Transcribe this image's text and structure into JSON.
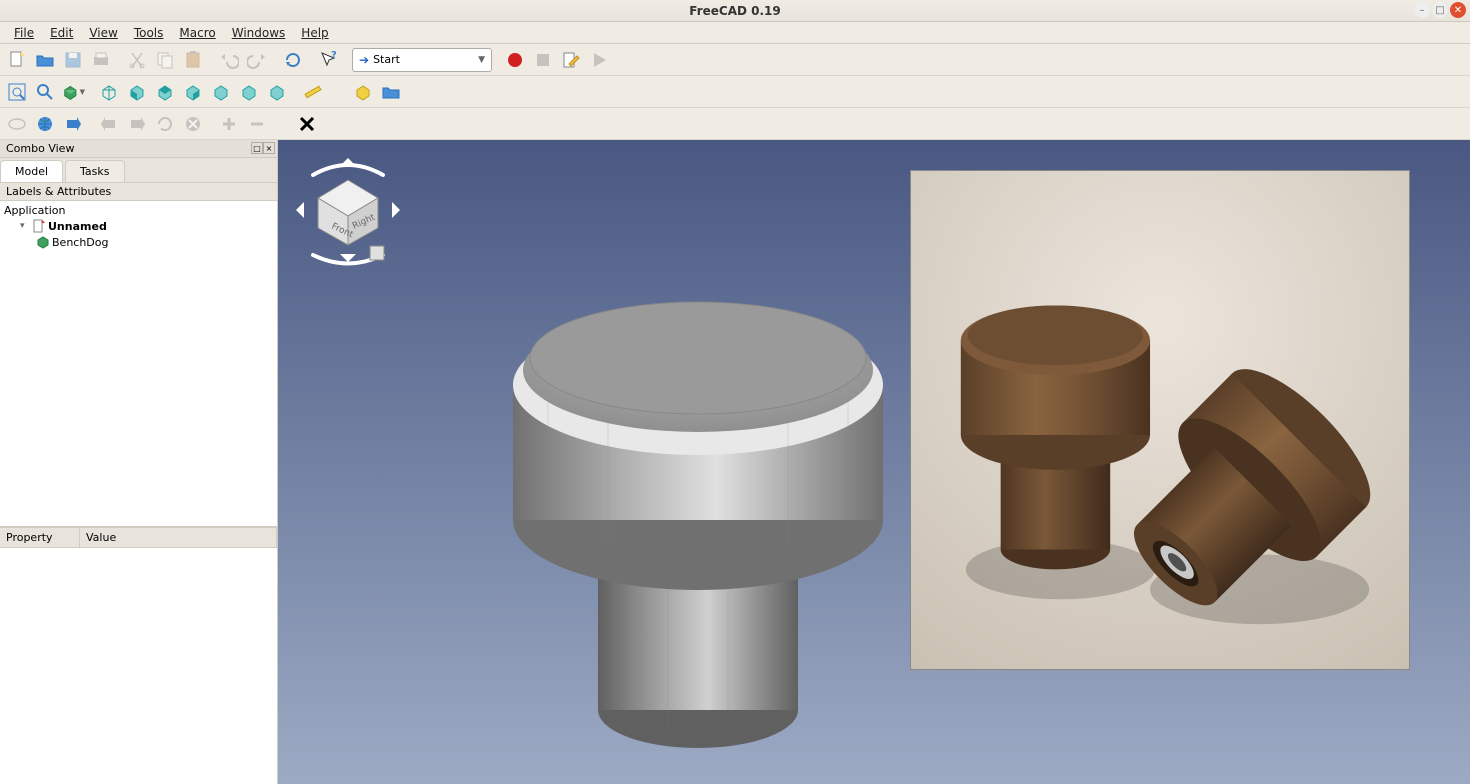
{
  "window": {
    "title": "FreeCAD 0.19"
  },
  "menus": [
    "File",
    "Edit",
    "View",
    "Tools",
    "Macro",
    "Windows",
    "Help"
  ],
  "menu_underline_index": [
    0,
    0,
    0,
    0,
    0,
    0,
    0
  ],
  "workbench_selector": {
    "label": "Start"
  },
  "combo_view": {
    "title": "Combo View",
    "tabs": [
      {
        "label": "Model",
        "active": true
      },
      {
        "label": "Tasks",
        "active": false
      }
    ],
    "labels_header": "Labels & Attributes",
    "tree": {
      "root": "Application",
      "document": "Unnamed",
      "object": "BenchDog"
    },
    "property_headers": [
      "Property",
      "Value"
    ]
  },
  "nav_cube": {
    "face_front": "Front",
    "face_right": "Right"
  },
  "icons": {
    "new": "new-document-icon",
    "open": "open-folder-icon",
    "save": "save-icon",
    "print": "print-icon",
    "cut": "cut-icon",
    "copy": "copy-icon",
    "paste": "paste-icon",
    "undo": "undo-icon",
    "redo": "redo-icon",
    "refresh": "refresh-icon",
    "whats_this": "whats-this-icon",
    "record": "macro-record-icon",
    "stop": "macro-stop-icon",
    "edit": "macro-edit-icon",
    "play": "macro-play-icon",
    "fit_all": "fit-all-icon",
    "fit_sel": "fit-selection-icon",
    "draw_style": "draw-style-icon",
    "iso": "view-iso-icon",
    "front": "view-front-icon",
    "top": "view-top-icon",
    "right": "view-right-icon",
    "rear": "view-rear-icon",
    "bottom": "view-bottom-icon",
    "left": "view-left-icon",
    "measure": "measure-icon",
    "part": "part-icon",
    "group": "group-icon",
    "nav_left": "nav-left-icon",
    "nav_globe": "nav-globe-icon",
    "nav_fwd": "nav-forward-icon",
    "nav_back_pg": "nav-back-page-icon",
    "nav_fwd_pg": "nav-forward-page-icon",
    "nav_reload": "nav-reload-icon",
    "nav_stop": "nav-stop-icon",
    "zoom_in": "zoom-in-icon",
    "zoom_out": "zoom-out-icon",
    "close_x": "close-x-icon"
  }
}
